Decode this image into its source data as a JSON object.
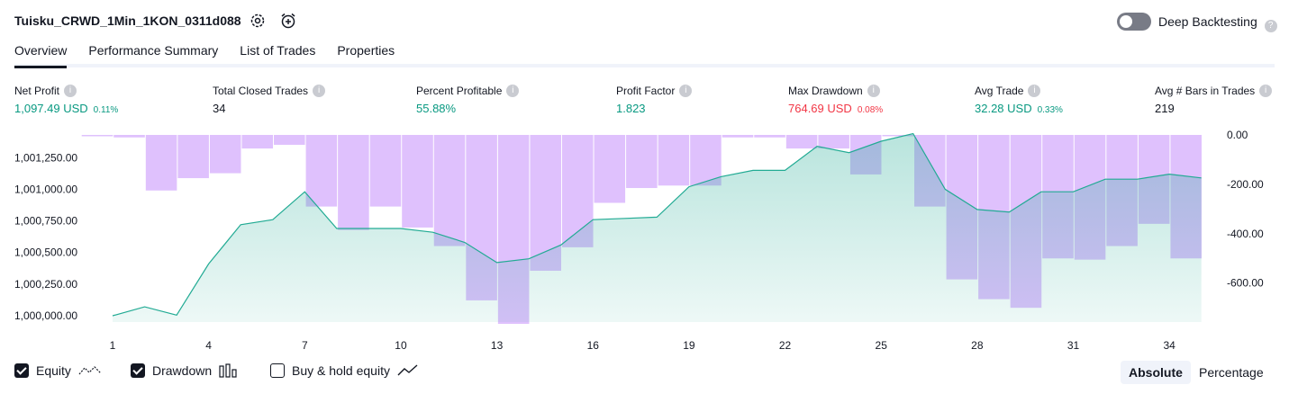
{
  "header": {
    "strategy_name": "Tuisku_CRWD_1Min_1KON_0311d088",
    "settings_icon": "gear-icon",
    "alert_icon": "alarm-clock-plus-icon",
    "deep_backtesting_label": "Deep Backtesting",
    "deep_backtesting_on": false,
    "help_glyph": "?"
  },
  "tabs": [
    {
      "label": "Overview",
      "active": true
    },
    {
      "label": "Performance Summary",
      "active": false
    },
    {
      "label": "List of Trades",
      "active": false
    },
    {
      "label": "Properties",
      "active": false
    }
  ],
  "stats": [
    {
      "label": "Net Profit",
      "value": "1,097.49 USD",
      "pct": "0.11%",
      "color": "#089981"
    },
    {
      "label": "Total Closed Trades",
      "value": "34",
      "pct": "",
      "color": "#131722"
    },
    {
      "label": "Percent Profitable",
      "value": "55.88%",
      "pct": "",
      "color": "#089981"
    },
    {
      "label": "Profit Factor",
      "value": "1.823",
      "pct": "",
      "color": "#089981"
    },
    {
      "label": "Max Drawdown",
      "value": "764.69 USD",
      "pct": "0.08%",
      "color": "#f23645"
    },
    {
      "label": "Avg Trade",
      "value": "32.28 USD",
      "pct": "0.33%",
      "color": "#089981"
    },
    {
      "label": "Avg # Bars in Trades",
      "value": "219",
      "pct": "",
      "color": "#131722"
    }
  ],
  "chart_data": {
    "type": "area",
    "x": [
      1,
      2,
      3,
      4,
      5,
      6,
      7,
      8,
      9,
      10,
      11,
      12,
      13,
      14,
      15,
      16,
      17,
      18,
      19,
      20,
      21,
      22,
      23,
      24,
      25,
      26,
      27,
      28,
      29,
      30,
      31,
      32,
      33,
      34,
      35
    ],
    "x_ticks": [
      "1",
      "4",
      "7",
      "10",
      "13",
      "16",
      "19",
      "22",
      "25",
      "28",
      "31",
      "34"
    ],
    "left_ticks": [
      "1,001,250.00",
      "1,001,000.00",
      "1,000,750.00",
      "1,000,500.00",
      "1,000,250.00",
      "1,000,000.00"
    ],
    "right_ticks": [
      "0.00",
      "-200.00",
      "-400.00",
      "-600.00"
    ],
    "series": [
      {
        "name": "Equity",
        "axis": "left",
        "color": "#22ab94",
        "values": [
          1000000,
          1000070,
          1000005,
          1000410,
          1000720,
          1000760,
          1000980,
          1000690,
          1000690,
          1000690,
          1000660,
          1000580,
          1000420,
          1000450,
          1000560,
          1000760,
          1000770,
          1000780,
          1001020,
          1001100,
          1001150,
          1001150,
          1001340,
          1001290,
          1001380,
          1001440,
          1001000,
          1000840,
          1000820,
          1000980,
          1000980,
          1001080,
          1001080,
          1001120,
          1001090
        ]
      },
      {
        "name": "Drawdown",
        "axis": "right",
        "color": "#c084fc",
        "values": [
          -5,
          -10,
          -225,
          -175,
          -155,
          -55,
          -40,
          -290,
          -385,
          -290,
          -375,
          -450,
          -670,
          -765,
          -550,
          -455,
          -275,
          -215,
          -205,
          -205,
          -10,
          -10,
          -55,
          -55,
          -160,
          -5,
          -290,
          -585,
          -665,
          -700,
          -500,
          -505,
          -450,
          -360,
          -500
        ]
      }
    ],
    "left_ylim": [
      999950,
      1001430
    ],
    "right_ylim": [
      -765,
      0
    ],
    "grid": false
  },
  "legend": [
    {
      "label": "Equity",
      "checked": true,
      "icon": "equity-line-icon"
    },
    {
      "label": "Drawdown",
      "checked": true,
      "icon": "drawdown-bars-icon"
    },
    {
      "label": "Buy & hold equity",
      "checked": false,
      "icon": "buy-hold-line-icon"
    }
  ],
  "view_toggle": {
    "absolute": "Absolute",
    "percentage": "Percentage",
    "selected": "Absolute"
  }
}
